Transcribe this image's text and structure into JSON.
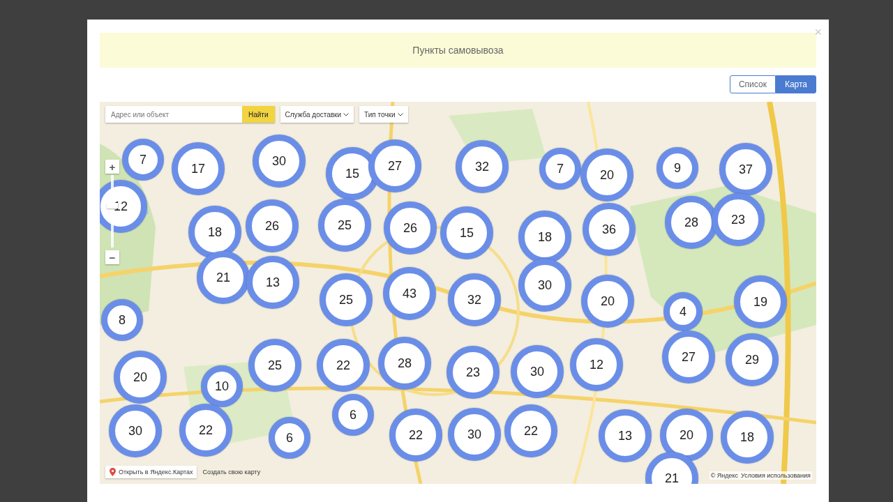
{
  "dialog": {
    "title": "Пункты самовывоза",
    "close": "×"
  },
  "view_toggle": [
    {
      "label": "Список",
      "selected": false
    },
    {
      "label": "Карта",
      "selected": true
    }
  ],
  "map": {
    "kind": "picture",
    "search": {
      "placeholder": "Адрес или объект"
    },
    "search_button": "Найти",
    "filters": [
      "Служба доставки",
      "Тип точки"
    ],
    "zoom_in": "+",
    "zoom_out": "−",
    "zoom": {
      "level": 0.58
    },
    "clusters": [
      "7",
      "17",
      "30",
      "15",
      "27",
      "32",
      "7",
      "20",
      "9",
      "37",
      "12",
      "18",
      "26",
      "25",
      "26",
      "15",
      "18",
      "36",
      "28",
      "23",
      "21",
      "13",
      "25",
      "43",
      "32",
      "30",
      "20",
      "4",
      "19",
      "8",
      "20",
      "25",
      "22",
      "28",
      "23",
      "30",
      "12",
      "27",
      "29",
      "10",
      "6",
      "30",
      "22",
      "6",
      "22",
      "30",
      "22",
      "13",
      "20",
      "18",
      "21"
    ],
    "open_link": "Открыть в Яндекс.Картах",
    "create_link": "Создать свою карту",
    "copyright": "© Яндекс",
    "terms_link": "Условия использования"
  }
}
